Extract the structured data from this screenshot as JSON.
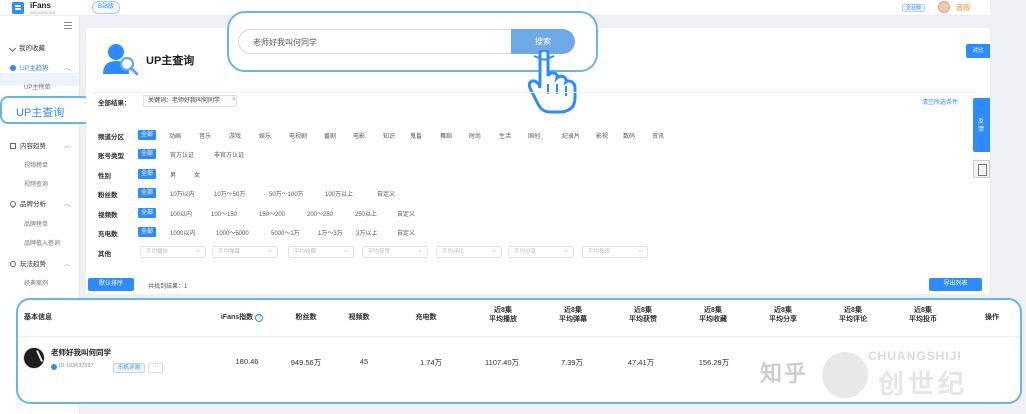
{
  "brand": {
    "name": "iFans",
    "tagline": "INFLUENCER",
    "version_pill": "B站版"
  },
  "topbar": {
    "badge": "企业版",
    "username": "薇薇"
  },
  "sidebar": {
    "favorites": "我的收藏",
    "up_section": "UP主趋势",
    "up_rank": "UP主榜单",
    "up_query": "UP主查询",
    "content_section": "内容趋势",
    "video_rank": "视频榜单",
    "video_query": "视频查询",
    "brand_section": "品牌分析",
    "brand_rank": "品牌榜单",
    "brand_input": "品牌植入查询",
    "play_section": "玩法趋势",
    "classic_case": "经典案例"
  },
  "hero": {
    "title": "UP主查询"
  },
  "search": {
    "value": "老师好我叫何同学",
    "button": "搜索"
  },
  "side_tags": {
    "compare": "对比",
    "feedback": "反馈"
  },
  "filters": {
    "all_results_label": "全部结果：",
    "keyword_chip": "关键词：老师好我叫何同学",
    "clear_link": "清空所选条件",
    "all_label": "全部",
    "rows": [
      {
        "label": "频道分区",
        "options": [
          "动画",
          "音乐",
          "游戏",
          "娱乐",
          "电视剧",
          "番剧",
          "电影",
          "知识",
          "鬼畜",
          "舞蹈",
          "时尚",
          "生活",
          "国创",
          "纪录片",
          "影视",
          "数码",
          "资讯"
        ]
      },
      {
        "label": "账号类型",
        "options": [
          "官方认证",
          "非官方认证"
        ]
      },
      {
        "label": "性别",
        "options": [
          "男",
          "女"
        ]
      },
      {
        "label": "粉丝数",
        "options": [
          "10万以内",
          "10万～50万",
          "50万～100万",
          "100万以上",
          "自定义"
        ]
      },
      {
        "label": "视频数",
        "options": [
          "100以内",
          "100～150",
          "150～200",
          "200～250",
          "250以上",
          "自定义"
        ]
      },
      {
        "label": "充电数",
        "options": [
          "1000以内",
          "1000～5000",
          "5000～1万",
          "1万～3万",
          "3万以上",
          "自定义"
        ]
      }
    ],
    "other_label": "其他",
    "dropdowns": [
      "平均播放",
      "平均弹幕",
      "平均收藏",
      "平均获赞",
      "平均评论",
      "平均分享",
      "平均投币"
    ]
  },
  "actions": {
    "sort_button": "默认排序",
    "result_text": "共找到结果：1",
    "export_button": "导出列表"
  },
  "table": {
    "headers": [
      "基本信息",
      "iFans指数",
      "粉丝数",
      "视频数",
      "充电数",
      "近8集\n平均播放",
      "近8集\n平均弹幕",
      "近8集\n平均获赞",
      "近8集\n平均收藏",
      "近8集\n平均分享",
      "近8集\n平均评论",
      "近8集\n平均投币",
      "操作"
    ],
    "row": {
      "name": "老师好我叫何同学",
      "id": "ID 163637597",
      "tag": "乐机评测",
      "more": "···",
      "ifans_index": "180.46",
      "fans": "949.56万",
      "videos": "45",
      "charge": "1.74万",
      "avg_play": "1107.40万",
      "avg_danmu": "7.39万",
      "avg_like": "47.41万",
      "avg_collect": "156.29万"
    }
  },
  "watermark": {
    "zh": "知乎",
    "en": "CHUANGSHIJI",
    "cn": "创世纪"
  }
}
